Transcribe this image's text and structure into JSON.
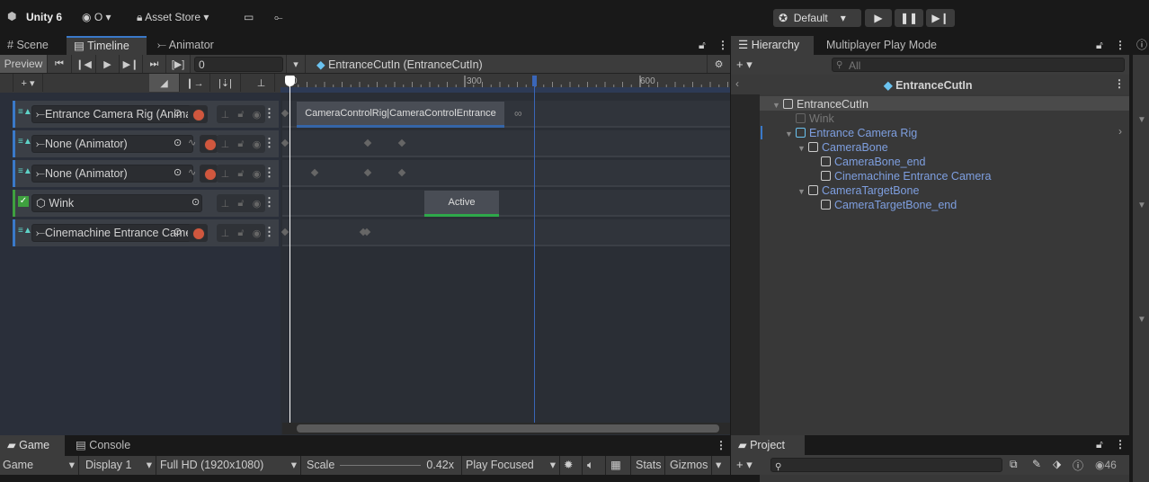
{
  "topbar": {
    "app": "Unity 6",
    "account": "O",
    "asset_store": "Asset Store",
    "layout": "Default"
  },
  "tabs": {
    "scene": "Scene",
    "timeline": "Timeline",
    "animator": "Animator"
  },
  "timeline": {
    "preview": "Preview",
    "frame": "0",
    "asset": "EntranceCutIn (EntranceCutIn)",
    "ruler": [
      "0",
      "300",
      "600"
    ],
    "tracks": [
      {
        "name": "Entrance Camera Rig (Animator)",
        "type": "animation",
        "color": "#3a79c9"
      },
      {
        "name": "None (Animator)",
        "type": "animation",
        "color": "#3a79c9"
      },
      {
        "name": "None (Animator)",
        "type": "animation",
        "color": "#3a79c9"
      },
      {
        "name": "Wink",
        "type": "activation",
        "color": "#3fa03f"
      },
      {
        "name": "Cinemachine Entrance Camera",
        "type": "animation",
        "color": "#3a79c9"
      }
    ],
    "clips": {
      "anim": "CameraControlRig|CameraControlEntrance",
      "active": "Active"
    },
    "infinity": "∞"
  },
  "game": {
    "tab_game": "Game",
    "tab_console": "Console",
    "view": "Game",
    "display": "Display 1",
    "resolution": "Full HD (1920x1080)",
    "scale_label": "Scale",
    "scale": "0.42x",
    "play_mode": "Play Focused",
    "stats": "Stats",
    "gizmos": "Gizmos"
  },
  "hierarchy": {
    "tab": "Hierarchy",
    "tab2": "Multiplayer Play Mode",
    "search": "All",
    "prefab": "EntranceCutIn",
    "items": [
      "EntranceCutIn",
      "Wink",
      "Entrance Camera Rig",
      "CameraBone",
      "CameraBone_end",
      "Cinemachine Entrance Camera",
      "CameraTargetBone",
      "CameraTargetBone_end"
    ]
  },
  "project": {
    "tab": "Project",
    "count": "46"
  }
}
